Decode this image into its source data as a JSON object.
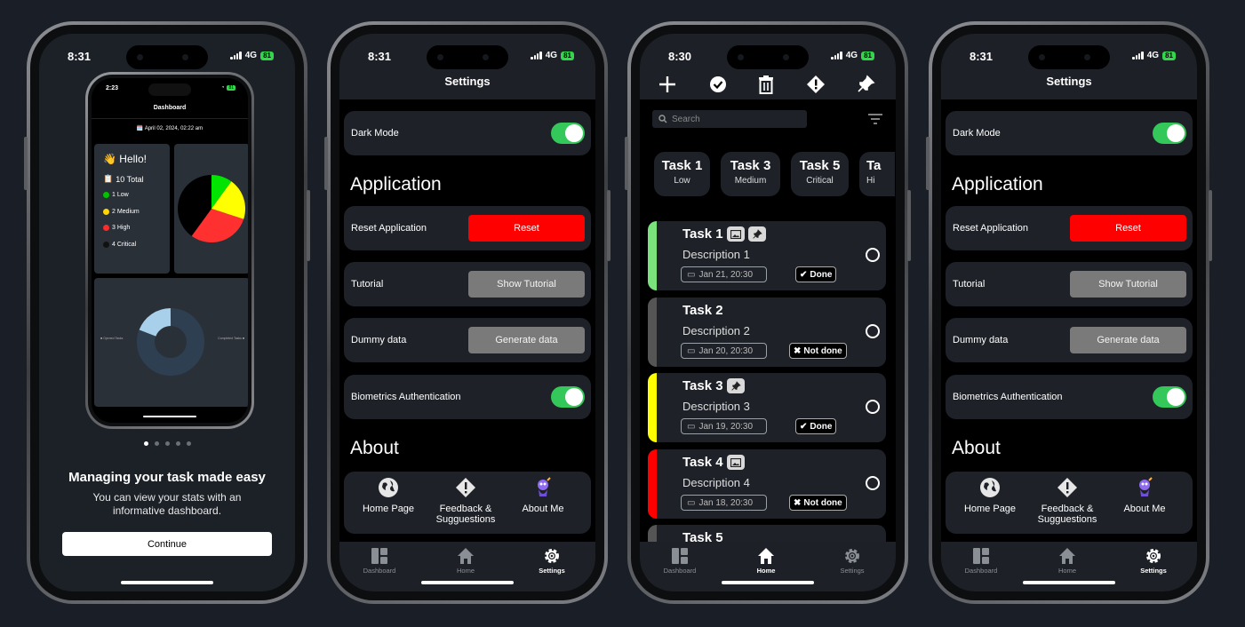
{
  "status": {
    "time_p1": "8:31",
    "time_p2": "8:31",
    "time_p3": "8:30",
    "time_p4": "8:31",
    "network": "4G",
    "battery": "81"
  },
  "onboarding": {
    "mini": {
      "time": "2:23",
      "title": "Dashboard",
      "date": "April 02, 2024, 02:22 am",
      "hello": "👋 Hello!",
      "stats": [
        {
          "label": "10 Total"
        },
        {
          "label": "1 Low",
          "color": "#00c400"
        },
        {
          "label": "2 Medium",
          "color": "#ffd700"
        },
        {
          "label": "3 High",
          "color": "#ff2a2a"
        },
        {
          "label": "4 Critical",
          "color": "#111111"
        }
      ],
      "pie": [
        {
          "label": "Low",
          "value": 1,
          "color": "#00e400"
        },
        {
          "label": "Medium",
          "value": 2,
          "color": "#ffff00"
        },
        {
          "label": "High",
          "value": 3,
          "color": "#ff3030"
        },
        {
          "label": "Critical",
          "value": 4,
          "color": "#000000"
        }
      ],
      "donut_left": "Opened Tasks",
      "donut_right": "Completed Tasks"
    },
    "dots_active": 0,
    "dot_count": 5,
    "title": "Managing your task made easy",
    "subtitle": "You can view your stats with an informative dashboard.",
    "continue_label": "Continue"
  },
  "settings": {
    "title": "Settings",
    "dark_mode": "Dark Mode",
    "section_application": "Application",
    "reset_label": "Reset Application",
    "reset_button": "Reset",
    "tutorial_label": "Tutorial",
    "tutorial_button": "Show Tutorial",
    "dummy_label": "Dummy data",
    "dummy_button": "Generate data",
    "biometrics_label": "Biometrics Authentication",
    "section_about": "About",
    "about_items": [
      "Home Page",
      "Feedback & Sugguestions",
      "About Me"
    ]
  },
  "tabs": [
    "Dashboard",
    "Home",
    "Settings"
  ],
  "home": {
    "search_placeholder": "Search",
    "chips": [
      {
        "title": "Task 1",
        "sub": "Low"
      },
      {
        "title": "Task 3",
        "sub": "Medium"
      },
      {
        "title": "Task 5",
        "sub": "Critical"
      },
      {
        "title": "Ta",
        "sub": "Hi"
      }
    ],
    "tasks": [
      {
        "title": "Task 1",
        "desc": "Description 1",
        "date": "Jan 21, 20:30",
        "status": "Done",
        "color": "#7be37b"
      },
      {
        "title": "Task 2",
        "desc": "Description 2",
        "date": "Jan 20, 20:30",
        "status": "Not done",
        "color": "#555555"
      },
      {
        "title": "Task 3",
        "desc": "Description 3",
        "date": "Jan 19, 20:30",
        "status": "Done",
        "color": "#ffff00"
      },
      {
        "title": "Task 4",
        "desc": "Description 4",
        "date": "Jan 18, 20:30",
        "status": "Not done",
        "color": "#ff0000"
      },
      {
        "title": "Task 5"
      }
    ]
  }
}
